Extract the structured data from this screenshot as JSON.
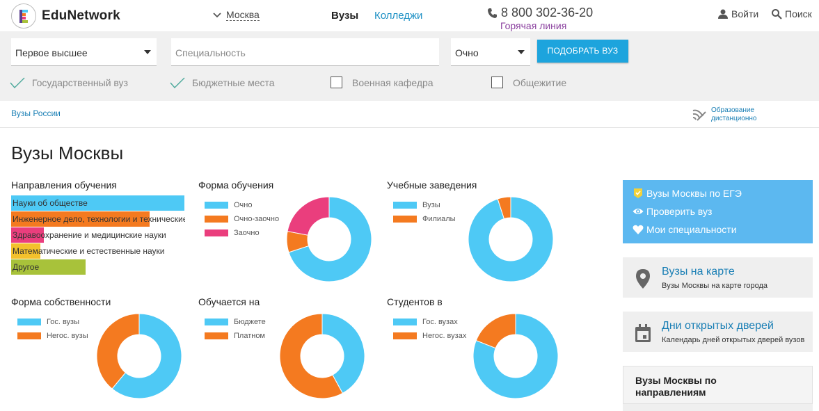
{
  "header": {
    "brand": "EduNetwork",
    "city": "Москва",
    "nav": {
      "universities": "Вузы",
      "colleges": "Колледжи"
    },
    "phone": "8 800 302-36-20",
    "hotline": "Горячая линия",
    "login": "Войти",
    "search": "Поиск"
  },
  "filters": {
    "level": "Первое высшее",
    "specialty_placeholder": "Специальность",
    "form": "Очно",
    "find_button": "ПОДОБРАТЬ ВУЗ",
    "checks": [
      {
        "label": "Государственный вуз",
        "checked": true
      },
      {
        "label": "Бюджетные места",
        "checked": true
      },
      {
        "label": "Военная кафедра",
        "checked": false
      },
      {
        "label": "Общежитие",
        "checked": false
      }
    ]
  },
  "breadcrumb": {
    "root": "Вузы России"
  },
  "distance": {
    "line1": "Образование",
    "line2": "дистанционно"
  },
  "page_title": "Вузы Москвы",
  "colors": {
    "blue": "#4ec9f5",
    "orange": "#f47a20",
    "pink": "#ea3e7d",
    "yellow": "#f3c12c",
    "green": "#a8c23a",
    "accent": "#1da4dd"
  },
  "chart_data": [
    {
      "type": "bar",
      "title": "Направления обучения",
      "categories": [
        "Науки об обществе",
        "Инженерное дело, технологии и технические науки",
        "Здравоохранение и медицинские науки",
        "Математические и естественные науки",
        "Другое"
      ],
      "values": [
        100,
        80,
        19,
        17,
        43
      ],
      "colors": [
        "#4ec9f5",
        "#f47a20",
        "#ea3e7d",
        "#f3c12c",
        "#a8c23a"
      ]
    },
    {
      "type": "pie",
      "title": "Форма обучения",
      "categories": [
        "Очно",
        "Очно-заочно",
        "Заочно"
      ],
      "values": [
        70,
        8,
        22
      ],
      "colors": [
        "#4ec9f5",
        "#f47a20",
        "#ea3e7d"
      ]
    },
    {
      "type": "pie",
      "title": "Учебные заведения",
      "categories": [
        "Вузы",
        "Филиалы"
      ],
      "values": [
        95,
        5
      ],
      "colors": [
        "#4ec9f5",
        "#f47a20"
      ]
    },
    {
      "type": "pie",
      "title": "Форма собственности",
      "categories": [
        "Гос. вузы",
        "Негос. вузы"
      ],
      "values": [
        61,
        39
      ],
      "colors": [
        "#4ec9f5",
        "#f47a20"
      ]
    },
    {
      "type": "pie",
      "title": "Обучается на",
      "categories": [
        "Бюджете",
        "Платном"
      ],
      "values": [
        42,
        58
      ],
      "colors": [
        "#4ec9f5",
        "#f47a20"
      ]
    },
    {
      "type": "pie",
      "title": "Студентов в",
      "categories": [
        "Гос. вузах",
        "Негос. вузах"
      ],
      "values": [
        81,
        19
      ],
      "colors": [
        "#4ec9f5",
        "#f47a20"
      ]
    }
  ],
  "sidebar": {
    "links": [
      "Вузы Москвы по ЕГЭ",
      "Проверить вуз",
      "Мои специальности"
    ],
    "map": {
      "title": "Вузы на карте",
      "subtitle": "Вузы Москвы на карте города"
    },
    "open_days": {
      "title": "Дни открытых дверей",
      "subtitle": "Календарь дней открытых дверей вузов"
    },
    "directions_title": "Вузы Москвы по направлениям"
  }
}
